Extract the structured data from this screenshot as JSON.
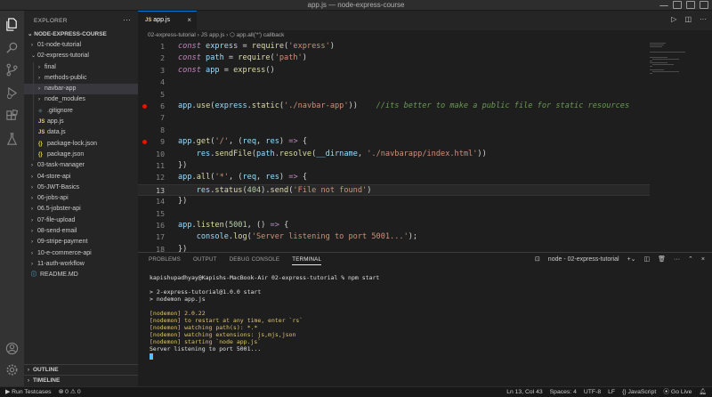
{
  "window": {
    "title": "app.js — node-express-course"
  },
  "sidebar": {
    "header": "EXPLORER",
    "project": "NODE-EXPRESS-COURSE",
    "tree": [
      {
        "label": "01-node-tutorial",
        "type": "folder",
        "indent": 1,
        "open": false
      },
      {
        "label": "02-express-tutorial",
        "type": "folder",
        "indent": 1,
        "open": true
      },
      {
        "label": "final",
        "type": "folder",
        "indent": 2,
        "open": false
      },
      {
        "label": "methods-public",
        "type": "folder",
        "indent": 2,
        "open": false
      },
      {
        "label": "navbar-app",
        "type": "folder",
        "indent": 2,
        "open": false,
        "selected": true
      },
      {
        "label": "node_modules",
        "type": "folder",
        "indent": 2,
        "open": false
      },
      {
        "label": ".gitignore",
        "type": "git",
        "indent": 2
      },
      {
        "label": "app.js",
        "type": "js",
        "indent": 2
      },
      {
        "label": "data.js",
        "type": "js",
        "indent": 2
      },
      {
        "label": "package-lock.json",
        "type": "json",
        "indent": 2
      },
      {
        "label": "package.json",
        "type": "json",
        "indent": 2
      },
      {
        "label": "03-task-manager",
        "type": "folder",
        "indent": 1,
        "open": false
      },
      {
        "label": "04-store-api",
        "type": "folder",
        "indent": 1,
        "open": false
      },
      {
        "label": "05-JWT-Basics",
        "type": "folder",
        "indent": 1,
        "open": false
      },
      {
        "label": "06-jobs-api",
        "type": "folder",
        "indent": 1,
        "open": false
      },
      {
        "label": "06.5-jobster-api",
        "type": "folder",
        "indent": 1,
        "open": false
      },
      {
        "label": "07-file-upload",
        "type": "folder",
        "indent": 1,
        "open": false
      },
      {
        "label": "08-send-email",
        "type": "folder",
        "indent": 1,
        "open": false
      },
      {
        "label": "09-stripe-payment",
        "type": "folder",
        "indent": 1,
        "open": false
      },
      {
        "label": "10-e-commerce-api",
        "type": "folder",
        "indent": 1,
        "open": false
      },
      {
        "label": "11-auth-workflow",
        "type": "folder",
        "indent": 1,
        "open": false
      },
      {
        "label": "README.MD",
        "type": "info",
        "indent": 1
      }
    ],
    "outline_label": "OUTLINE",
    "timeline_label": "TIMELINE"
  },
  "editor": {
    "tab_label": "app.js",
    "breadcrumb": "02-express-tutorial  ›  JS app.js  ›  ⬡ app.all('*') callback",
    "current_line": 13,
    "breakpoints": [
      6,
      9
    ],
    "lines": [
      [
        {
          "t": "const",
          "c": "k"
        },
        {
          "t": " express ",
          "c": "v"
        },
        {
          "t": "= ",
          "c": "p"
        },
        {
          "t": "require",
          "c": "f"
        },
        {
          "t": "(",
          "c": "p"
        },
        {
          "t": "'express'",
          "c": "s"
        },
        {
          "t": ")",
          "c": "p"
        }
      ],
      [
        {
          "t": "const",
          "c": "k"
        },
        {
          "t": " path ",
          "c": "v"
        },
        {
          "t": "= ",
          "c": "p"
        },
        {
          "t": "require",
          "c": "f"
        },
        {
          "t": "(",
          "c": "p"
        },
        {
          "t": "'path'",
          "c": "s"
        },
        {
          "t": ")",
          "c": "p"
        }
      ],
      [
        {
          "t": "const",
          "c": "k"
        },
        {
          "t": " app ",
          "c": "v"
        },
        {
          "t": "= ",
          "c": "p"
        },
        {
          "t": "express",
          "c": "f"
        },
        {
          "t": "()",
          "c": "p"
        }
      ],
      [],
      [],
      [
        {
          "t": "app",
          "c": "v"
        },
        {
          "t": ".",
          "c": "p"
        },
        {
          "t": "use",
          "c": "f"
        },
        {
          "t": "(",
          "c": "p"
        },
        {
          "t": "express",
          "c": "v"
        },
        {
          "t": ".",
          "c": "p"
        },
        {
          "t": "static",
          "c": "f"
        },
        {
          "t": "(",
          "c": "p"
        },
        {
          "t": "'./navbar-app'",
          "c": "s"
        },
        {
          "t": "))",
          "c": "p"
        },
        {
          "t": "    //its better to make a public file for static resources",
          "c": "c"
        }
      ],
      [],
      [],
      [
        {
          "t": "app",
          "c": "v"
        },
        {
          "t": ".",
          "c": "p"
        },
        {
          "t": "get",
          "c": "f"
        },
        {
          "t": "(",
          "c": "p"
        },
        {
          "t": "'/'",
          "c": "s"
        },
        {
          "t": ", (",
          "c": "p"
        },
        {
          "t": "req",
          "c": "v"
        },
        {
          "t": ", ",
          "c": "p"
        },
        {
          "t": "res",
          "c": "v"
        },
        {
          "t": ") ",
          "c": "p"
        },
        {
          "t": "=>",
          "c": "o"
        },
        {
          "t": " {",
          "c": "p"
        }
      ],
      [
        {
          "t": "    res",
          "c": "v"
        },
        {
          "t": ".",
          "c": "p"
        },
        {
          "t": "sendFile",
          "c": "f"
        },
        {
          "t": "(",
          "c": "p"
        },
        {
          "t": "path",
          "c": "v"
        },
        {
          "t": ".",
          "c": "p"
        },
        {
          "t": "resolve",
          "c": "f"
        },
        {
          "t": "(",
          "c": "p"
        },
        {
          "t": "__dirname",
          "c": "v"
        },
        {
          "t": ", ",
          "c": "p"
        },
        {
          "t": "'./navbarapp/index.html'",
          "c": "s"
        },
        {
          "t": "))",
          "c": "p"
        }
      ],
      [
        {
          "t": "})",
          "c": "p"
        }
      ],
      [
        {
          "t": "app",
          "c": "v"
        },
        {
          "t": ".",
          "c": "p"
        },
        {
          "t": "all",
          "c": "f"
        },
        {
          "t": "(",
          "c": "p"
        },
        {
          "t": "'*'",
          "c": "s"
        },
        {
          "t": ", (",
          "c": "p"
        },
        {
          "t": "req",
          "c": "v"
        },
        {
          "t": ", ",
          "c": "p"
        },
        {
          "t": "res",
          "c": "v"
        },
        {
          "t": ") ",
          "c": "p"
        },
        {
          "t": "=>",
          "c": "o"
        },
        {
          "t": " {",
          "c": "p"
        }
      ],
      [
        {
          "t": "    res",
          "c": "v"
        },
        {
          "t": ".",
          "c": "p"
        },
        {
          "t": "status",
          "c": "f"
        },
        {
          "t": "(",
          "c": "p"
        },
        {
          "t": "404",
          "c": "n"
        },
        {
          "t": ").",
          "c": "p"
        },
        {
          "t": "send",
          "c": "f"
        },
        {
          "t": "(",
          "c": "p"
        },
        {
          "t": "'File not found'",
          "c": "s"
        },
        {
          "t": ")",
          "c": "p"
        }
      ],
      [
        {
          "t": "})",
          "c": "p"
        }
      ],
      [],
      [
        {
          "t": "app",
          "c": "v"
        },
        {
          "t": ".",
          "c": "p"
        },
        {
          "t": "listen",
          "c": "f"
        },
        {
          "t": "(",
          "c": "p"
        },
        {
          "t": "5001",
          "c": "n"
        },
        {
          "t": ", () ",
          "c": "p"
        },
        {
          "t": "=>",
          "c": "o"
        },
        {
          "t": " {",
          "c": "p"
        }
      ],
      [
        {
          "t": "    console",
          "c": "v"
        },
        {
          "t": ".",
          "c": "p"
        },
        {
          "t": "log",
          "c": "f"
        },
        {
          "t": "(",
          "c": "p"
        },
        {
          "t": "'Server listening to port 5001...'",
          "c": "s"
        },
        {
          "t": ");",
          "c": "p"
        }
      ],
      [
        {
          "t": "})",
          "c": "p"
        }
      ]
    ]
  },
  "panel": {
    "tabs": [
      "PROBLEMS",
      "OUTPUT",
      "DEBUG CONSOLE",
      "TERMINAL"
    ],
    "active_tab": "TERMINAL",
    "terminal_selector": "node - 02-express-tutorial",
    "terminal_lines": [
      {
        "text": "kapishupadhyay@Kapishs-MacBook-Air 02-express-tutorial % npm start",
        "c": "w"
      },
      {
        "text": "",
        "c": "w"
      },
      {
        "text": "> 2-express-tutorial@1.0.0 start",
        "c": "w"
      },
      {
        "text": "> nodemon app.js",
        "c": "w"
      },
      {
        "text": "",
        "c": "w"
      },
      {
        "text": "[nodemon] 2.0.22",
        "c": "y"
      },
      {
        "text": "[nodemon] to restart at any time, enter `rs`",
        "c": "y"
      },
      {
        "text": "[nodemon] watching path(s): *.*",
        "c": "y"
      },
      {
        "text": "[nodemon] watching extensions: js,mjs,json",
        "c": "y"
      },
      {
        "text": "[nodemon] starting `node app.js`",
        "c": "y"
      },
      {
        "text": "Server listening to port 5001...",
        "c": "w"
      }
    ]
  },
  "statusbar": {
    "run_tests": "Run Testcases",
    "problems": "⊗ 0  ⚠ 0",
    "position": "Ln 13, Col 43",
    "spaces": "Spaces: 4",
    "encoding": "UTF-8",
    "eol": "LF",
    "language": "{} JavaScript",
    "golive": "⦿ Go Live"
  },
  "colors": {
    "accent": "#0078d4",
    "breakpoint": "#e51400",
    "editor_bg": "#1e1e1e",
    "sidebar_bg": "#252526"
  }
}
